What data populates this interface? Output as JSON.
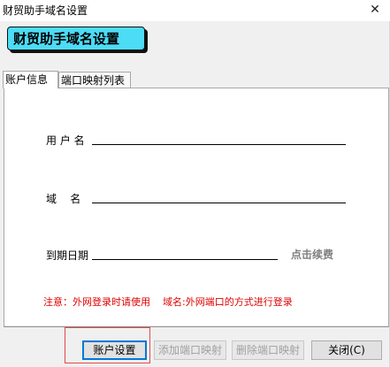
{
  "window": {
    "title": "财贸助手域名设置",
    "close_glyph": "✕"
  },
  "banner": {
    "text": "财贸助手域名设置"
  },
  "tabs": [
    {
      "label": "账户信息",
      "active": true
    },
    {
      "label": "端口映射列表",
      "active": false
    }
  ],
  "form": {
    "username_label": "用 户 名",
    "username_value": "",
    "domain_label": "域    名",
    "domain_value": "",
    "expiry_label": "到期日期",
    "expiry_value": "",
    "renew_link": "点击续费",
    "notice": "注意：外网登录时请使用    域名:外网端口的方式进行登录"
  },
  "buttons": {
    "account_settings": "账户设置",
    "add_port_mapping": "添加端口映射",
    "delete_port_mapping": "删除端口映射",
    "close": "关闭(C)"
  },
  "colors": {
    "banner_bg": "#4cdcf6",
    "notice": "#e00000",
    "highlight": "#e04a4a",
    "link": "#808080"
  }
}
